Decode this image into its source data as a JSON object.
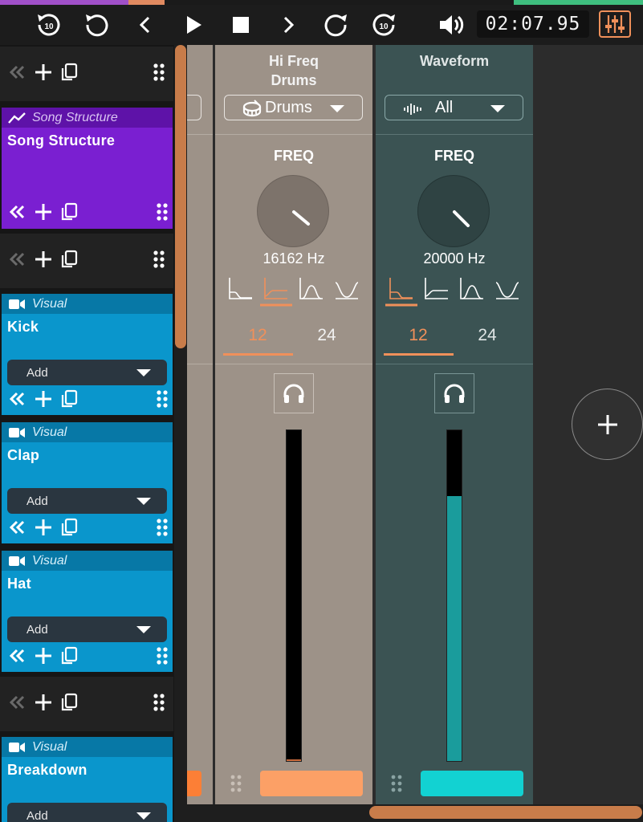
{
  "transport": {
    "timecode": "02:07.95",
    "skip_back_amount": "10",
    "skip_forward_amount": "10"
  },
  "left_panel": {
    "cards": [
      {
        "type": "Song Structure",
        "name": "Song Structure",
        "color": "#7a1fd1"
      },
      {
        "type": "Visual",
        "name": "Kick",
        "dropdown": "Add",
        "color": "#0a96cc"
      },
      {
        "type": "Visual",
        "name": "Clap",
        "dropdown": "Add",
        "color": "#0a96cc"
      },
      {
        "type": "Visual",
        "name": "Hat",
        "dropdown": "Add",
        "color": "#0a96cc"
      },
      {
        "type": "Visual",
        "name": "Breakdown",
        "dropdown": "Add",
        "color": "#0a96cc"
      }
    ]
  },
  "strips": [
    {
      "title_line1": "Hi Freq",
      "title_line2": "Drums",
      "source": "Drums",
      "freq_label": "FREQ",
      "freq_value": "16162 Hz",
      "filter_selected": "low-shelf",
      "slope_a": "12",
      "slope_b": "24",
      "slope_selected": "12",
      "meter_level": 0.005,
      "color": "#fca066"
    },
    {
      "title_line1": "Waveform",
      "title_line2": "",
      "source": "All",
      "freq_label": "FREQ",
      "freq_value": "20000 Hz",
      "filter_selected": "high-pass",
      "slope_a": "12",
      "slope_b": "24",
      "slope_selected": "12",
      "meter_level": 0.8,
      "color": "#12d2d2"
    }
  ],
  "colors": {
    "accent": "#f0905a",
    "purple": "#7a1fd1",
    "blue": "#0a96cc",
    "teal_meter": "#1a9c9c"
  }
}
